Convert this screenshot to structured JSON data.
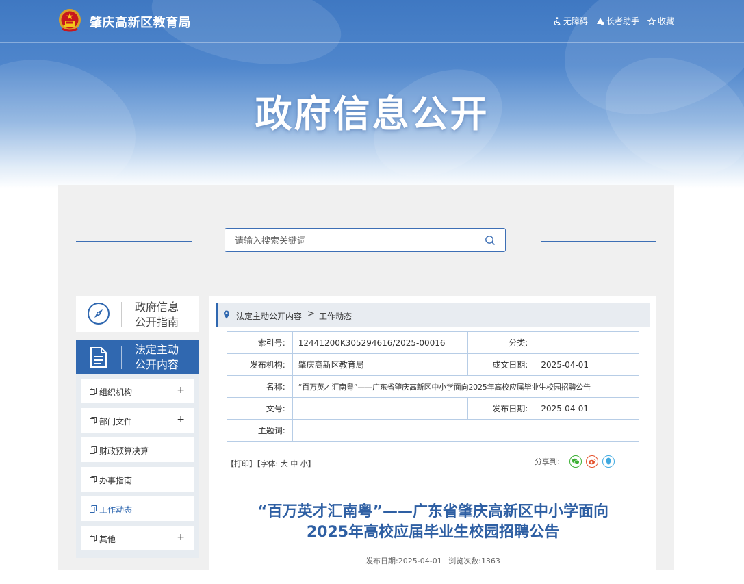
{
  "header": {
    "site_name": "肇庆高新区教育局",
    "links": [
      {
        "label": "无障碍",
        "icon": "accessibility-icon"
      },
      {
        "label": "长者助手",
        "icon": "elder-assist-icon"
      },
      {
        "label": "收藏",
        "icon": "star-icon"
      }
    ],
    "banner_title": "政府信息公开"
  },
  "search": {
    "placeholder": "请输入搜索关键词"
  },
  "sidebar": {
    "guide_line1": "政府信息",
    "guide_line2": "公开指南",
    "active_line1": "法定主动",
    "active_line2": "公开内容",
    "items": [
      {
        "label": "组织机构",
        "expand": "+"
      },
      {
        "label": "部门文件",
        "expand": "+"
      },
      {
        "label": "财政预算决算",
        "expand": ""
      },
      {
        "label": "办事指南",
        "expand": ""
      },
      {
        "label": "工作动态",
        "expand": ""
      },
      {
        "label": "其他",
        "expand": "+"
      }
    ]
  },
  "breadcrumb": {
    "level1": "法定主动公开内容",
    "separator": ">",
    "level2": "工作动态"
  },
  "meta": {
    "index_label": "索引号:",
    "index_value": "12441200K305294616/2025-00016",
    "category_label": "分类:",
    "category_value": "",
    "publisher_label": "发布机构:",
    "publisher_value": "肇庆高新区教育局",
    "written_date_label": "成文日期:",
    "written_date_value": "2025-04-01",
    "name_label": "名称:",
    "name_value": "“百万英才汇南粤”——广东省肇庆高新区中小学面向2025年高校应届毕业生校园招聘公告",
    "doc_no_label": "文号:",
    "doc_no_value": "",
    "publish_date_label": "发布日期:",
    "publish_date_value": "2025-04-01",
    "subject_label": "主题词:",
    "subject_value": ""
  },
  "tools": {
    "print": "【打印】",
    "font_prefix": "【字体:",
    "large": "大",
    "medium": "中",
    "small": "小",
    "font_suffix": "】",
    "share_label": "分享到:"
  },
  "article": {
    "title_line1": "“百万英才汇南粤”——广东省肇庆高新区中小学面向",
    "title_line2": "2025年高校应届毕业生校园招聘公告",
    "info_date_label": "发布日期:",
    "info_date": "2025-04-01",
    "info_views_label": "浏览次数:",
    "info_views": "1363"
  },
  "colors": {
    "primary": "#3068b0",
    "title": "#2e5fa3",
    "wechat": "#3cb034",
    "weibo": "#e5542f",
    "qq": "#3fa9e0"
  }
}
